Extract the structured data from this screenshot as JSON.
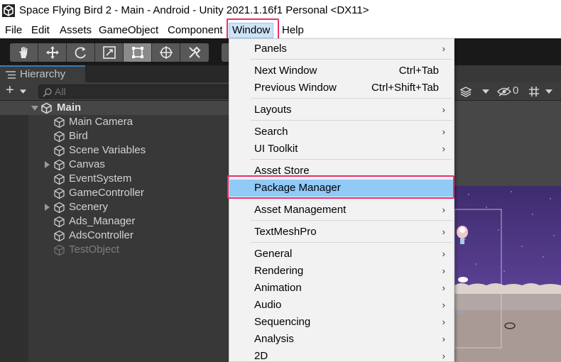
{
  "window": {
    "title": "Space Flying Bird 2 - Main - Android - Unity 2021.1.16f1 Personal <DX11>",
    "icon": "unity-logo-icon"
  },
  "menubar": {
    "items": [
      "File",
      "Edit",
      "Assets",
      "GameObject",
      "Component",
      "Window",
      "Help"
    ],
    "active": "Window"
  },
  "toolbar": {
    "tools": [
      "hand-tool-icon",
      "move-tool-icon",
      "rotate-tool-icon",
      "scale-tool-icon",
      "rect-tool-icon",
      "transform-tool-icon",
      "custom-tool-icon"
    ],
    "active_tool": "rect-tool-icon"
  },
  "hierarchy": {
    "tab_label": "Hierarchy",
    "add_label": "+",
    "search_placeholder": "All",
    "scene": "Main",
    "items": [
      {
        "label": "Main Camera",
        "expandable": false,
        "enabled": true
      },
      {
        "label": "Bird",
        "expandable": false,
        "enabled": true
      },
      {
        "label": "Scene Variables",
        "expandable": false,
        "enabled": true
      },
      {
        "label": "Canvas",
        "expandable": true,
        "enabled": true
      },
      {
        "label": "EventSystem",
        "expandable": false,
        "enabled": true
      },
      {
        "label": "GameController",
        "expandable": false,
        "enabled": true
      },
      {
        "label": "Scenery",
        "expandable": true,
        "enabled": true
      },
      {
        "label": "Ads_Manager",
        "expandable": false,
        "enabled": true
      },
      {
        "label": "AdsController",
        "expandable": false,
        "enabled": true
      },
      {
        "label": "TestObject",
        "expandable": false,
        "enabled": false
      }
    ]
  },
  "scene_view": {
    "hidden_count": "0"
  },
  "window_menu": {
    "items": [
      {
        "label": "Panels",
        "shortcut": "",
        "submenu": true
      },
      {
        "label": "Next Window",
        "shortcut": "Ctrl+Tab",
        "submenu": false
      },
      {
        "label": "Previous Window",
        "shortcut": "Ctrl+Shift+Tab",
        "submenu": false
      },
      {
        "label": "Layouts",
        "shortcut": "",
        "submenu": true
      },
      {
        "label": "Search",
        "shortcut": "",
        "submenu": true
      },
      {
        "label": "UI Toolkit",
        "shortcut": "",
        "submenu": true
      },
      {
        "label": "Asset Store",
        "shortcut": "",
        "submenu": false
      },
      {
        "label": "Package Manager",
        "shortcut": "",
        "submenu": false
      },
      {
        "label": "Asset Management",
        "shortcut": "",
        "submenu": true
      },
      {
        "label": "TextMeshPro",
        "shortcut": "",
        "submenu": true
      },
      {
        "label": "General",
        "shortcut": "",
        "submenu": true
      },
      {
        "label": "Rendering",
        "shortcut": "",
        "submenu": true
      },
      {
        "label": "Animation",
        "shortcut": "",
        "submenu": true
      },
      {
        "label": "Audio",
        "shortcut": "",
        "submenu": true
      },
      {
        "label": "Sequencing",
        "shortcut": "",
        "submenu": true
      },
      {
        "label": "Analysis",
        "shortcut": "",
        "submenu": true
      },
      {
        "label": "2D",
        "shortcut": "",
        "submenu": true
      }
    ],
    "highlighted": "Package Manager",
    "submenu_glyph": "›"
  },
  "colors": {
    "annotation": "#e8316b",
    "menu_highlight": "#91c9f7",
    "editor_dark": "#383838",
    "sky_purple": "#4b3583"
  }
}
